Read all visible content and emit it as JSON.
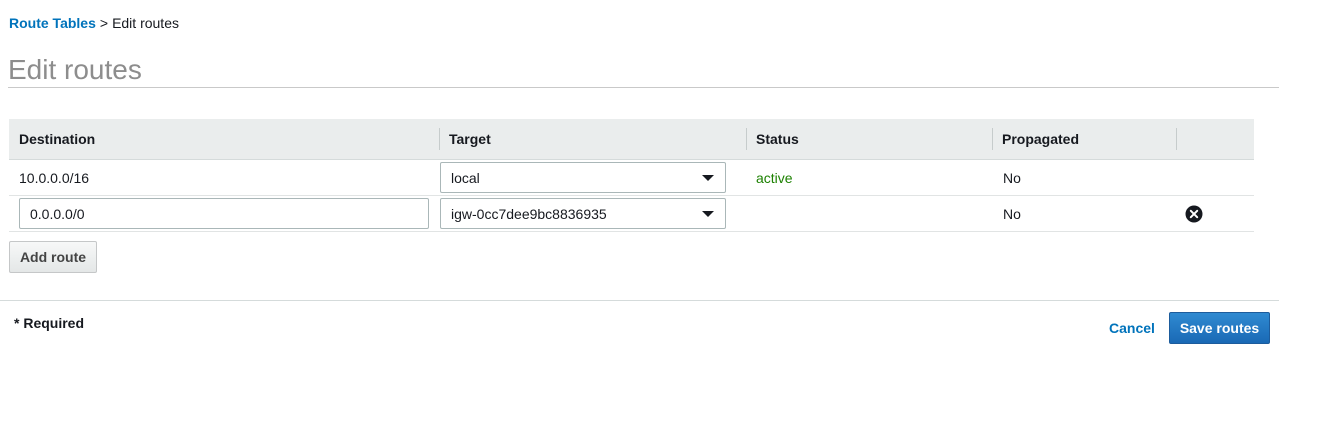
{
  "breadcrumb": {
    "parent": "Route Tables",
    "separator": ">",
    "current": "Edit routes"
  },
  "page": {
    "title": "Edit routes"
  },
  "table": {
    "columns": [
      "Destination",
      "Target",
      "Status",
      "Propagated",
      ""
    ],
    "rows": [
      {
        "destination": "10.0.0.0/16",
        "target": "local",
        "status": "active",
        "propagated": "No",
        "removable": false
      },
      {
        "destination": "0.0.0.0/0",
        "target": "igw-0cc7dee9bc8836935",
        "status": "",
        "propagated": "No",
        "removable": true
      }
    ]
  },
  "actions": {
    "add_route": "Add route",
    "required_note": "* Required",
    "cancel": "Cancel",
    "save": "Save routes"
  },
  "icons": {
    "remove": "remove-circle-icon",
    "dropdown": "chevron-down-icon"
  },
  "colors": {
    "link": "#0073bb",
    "status_active": "#1d8102",
    "primary_button": "#1a69b5",
    "header_bg": "#eaeded",
    "title": "#8d8d8d"
  }
}
